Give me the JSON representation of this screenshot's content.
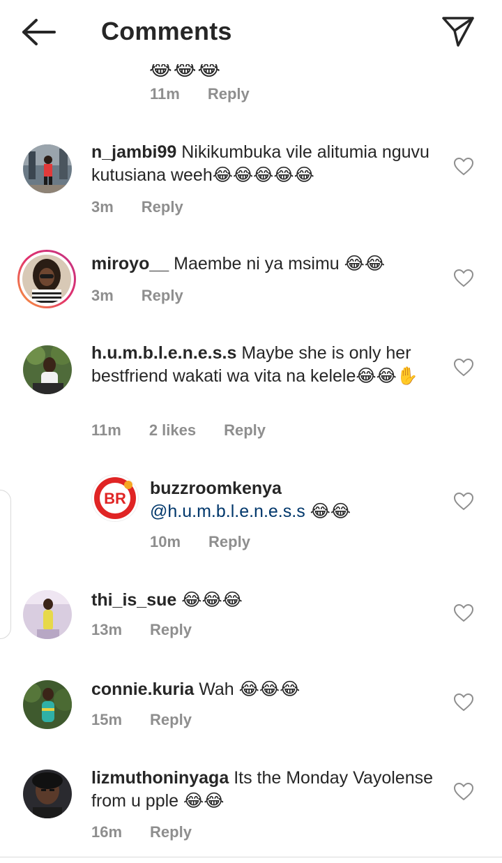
{
  "header": {
    "title": "Comments",
    "back_icon": "arrow-left-icon",
    "share_icon": "paper-plane-icon"
  },
  "partial_comment": {
    "emoji": "😂😂😂",
    "time": "11m",
    "reply_label": "Reply"
  },
  "comments": [
    {
      "username": "n_jambi99",
      "text": "Nikikumbuka vile alitumia nguvu kutusiana weeh😂😂😂😂😂",
      "time": "3m",
      "likes": "",
      "reply_label": "Reply"
    },
    {
      "username": "miroyo__",
      "text": "Maembe ni ya msimu 😂😂",
      "time": "3m",
      "likes": "",
      "reply_label": "Reply"
    },
    {
      "username": "h.u.m.b.l.e.n.e.s.s",
      "text": "Maybe she is only her bestfriend wakati wa vita na kelele😂😂✋",
      "time": "11m",
      "likes": "2 likes",
      "reply_label": "Reply"
    },
    {
      "username": "buzzroomkenya",
      "mention": "@h.u.m.b.l.e.n.e.s.s",
      "text": "😂😂",
      "time": "10m",
      "likes": "",
      "reply_label": "Reply",
      "avatar_text": "BR"
    },
    {
      "username": "thi_is_sue",
      "text": "😂😂😂",
      "time": "13m",
      "likes": "",
      "reply_label": "Reply"
    },
    {
      "username": "connie.kuria",
      "text": "Wah 😂😂😂",
      "time": "15m",
      "likes": "",
      "reply_label": "Reply"
    },
    {
      "username": "lizmuthoninyaga",
      "text": "Its the Monday Vayolense from u pple 😂😂",
      "time": "16m",
      "likes": "",
      "reply_label": "Reply"
    }
  ],
  "colors": {
    "text": "#262626",
    "meta": "#8e8e8e",
    "mention": "#00376b",
    "story_ring": "#e1306c",
    "brand_red": "#e02424"
  }
}
